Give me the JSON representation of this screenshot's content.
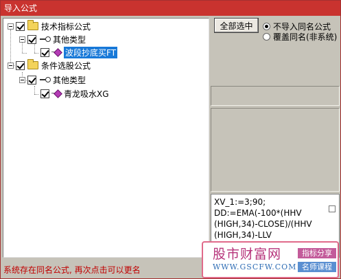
{
  "window": {
    "title": "导入公式"
  },
  "tree": {
    "root1": {
      "label": "技术指标公式",
      "child": {
        "label": "其他类型",
        "leaf": "波段抄底买FT"
      }
    },
    "root2": {
      "label": "条件选股公式",
      "child": {
        "label": "其他类型",
        "leaf": "青龙吸水XG"
      }
    }
  },
  "controls": {
    "select_all": "全部选中",
    "radio_skip": "不导入同名公式",
    "radio_overwrite": "覆盖同名(非系统)"
  },
  "code": {
    "lines": [
      "XV_1:=3;90;",
      "DD:=EMA(-100*(HHV",
      "(HIGH,34)-CLOSE)/(HHV",
      "(HIGH,34)-LLV"
    ]
  },
  "status": {
    "message": "系统存在同名公式, 再次点击可以更名"
  },
  "watermark": {
    "title": "股市财富网",
    "url": "WWW.GSCFW.COM",
    "badge1": "指标分享",
    "badge2": "名师课程"
  },
  "colors": {
    "titlebar": "#c9332f",
    "selection": "#1879d8",
    "status_text": "#c00000"
  }
}
